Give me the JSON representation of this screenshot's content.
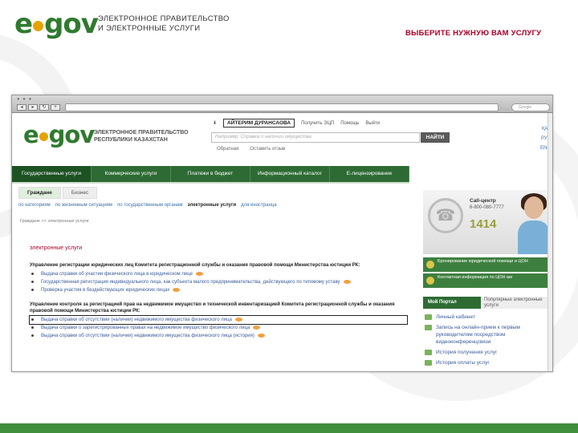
{
  "slide": {
    "logo_e": "e",
    "logo_gov": "gov",
    "header_line1": "ЭЛЕКТРОННОЕ ПРАВИТЕЛЬСТВО",
    "header_line2": "И ЭЛЕКТРОННЫЕ УСЛУГИ",
    "title": "ВЫБЕРИТЕ НУЖНУЮ ВАМ УСЛУГУ"
  },
  "browser": {
    "search_placeholder": "Google"
  },
  "site": {
    "logo_e": "e",
    "logo_gov": "gov",
    "header_line1": "ЭЛЕКТРОННОЕ ПРАВИТЕЛЬСТВО",
    "header_line2": "РЕСПУБЛИКИ КАЗАХСТАН",
    "user_name": "АЙТЕРИМ ДУРАНСАОВА",
    "link_get_eds": "Получить ЭЦП",
    "link_help": "Помощь",
    "link_logout": "Выйти",
    "search_placeholder": "Например: Справка о наличии имущества",
    "search_button": "НАЙТИ",
    "sub_link_feedback": "Обратная",
    "sub_link_leave_review": "Оставить отзыв",
    "lang": [
      "ҚАЗ",
      "РУС",
      "ENG"
    ],
    "nav": [
      "Государственные услуги",
      "Коммерческие услуги",
      "Платежи в бюджет",
      "Информационный каталог",
      "E-лицензирование"
    ],
    "tabs": [
      "Граждане",
      "Бизнес"
    ],
    "filters": [
      "по категориям",
      "по жизненным ситуациям",
      "по государственным органам",
      "электронные услуги",
      "для иностранца"
    ],
    "breadcrumb": "Граждане >> электронные услуги",
    "section_title": "электронные услуги",
    "groups": [
      {
        "heading": "Управление регистрации юридических лиц Комитета регистрационной службы и оказания правовой помощи Министерства юстиции РК:",
        "items": [
          "Выдача справки об участии физического лица в юридическом лице",
          "Государственная регистрация индивидуального лица, как субъекта малого предпринимательства, действующего по типовому уставу",
          "Проверка участия в бездействующих юридических лицах"
        ]
      },
      {
        "heading": "Управление контроля за регистрацией прав на недвижимое имущество и технической инвентаризацией Комитета регистрационной службы и оказания правовой помощи Министерства юстиции РК:",
        "items": [
          "Выдача справки об отсутствии (наличии) недвижимого имущества физического лица",
          "Выдача справки о зарегистрированных правах на недвижимое имущество физического лица",
          "Выдача справки об отсутствии (наличии) недвижимого имущества физического лица (история)"
        ]
      }
    ],
    "callcenter_label": "Call-центр",
    "callcenter_phone": "8-800-080-7777",
    "callcenter_short": "1414",
    "banner1": "Бронирование юридической помощи и ЦОН",
    "banner2": "Контактная информация по ЦОН ам",
    "portal_title": "Мой Портал",
    "portal_sub": "Популярные электронные услуги",
    "portal_links": [
      "Личный кабинет",
      "Запись на онлайн-прием к первым руководителям посредством видеоконференцсвязи",
      "История получения услуг",
      "История оплаты услуг"
    ]
  },
  "colors": {
    "brand_green": "#2e6b34",
    "accent_red": "#a8002b",
    "logo_orange": "#e8a200"
  }
}
